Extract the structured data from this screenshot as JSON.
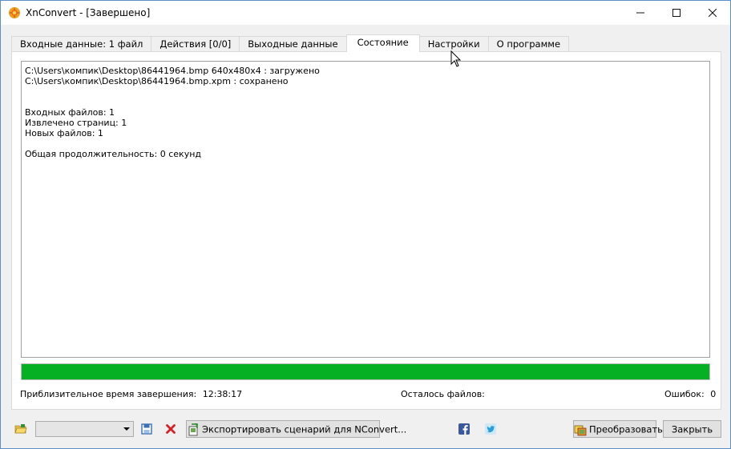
{
  "window": {
    "title": "XnConvert - [Завершено]",
    "minimize_icon": "minimize-icon",
    "maximize_icon": "maximize-icon",
    "close_icon": "close-icon"
  },
  "tabs": [
    {
      "label": "Входные данные: 1 файл",
      "active": false
    },
    {
      "label": "Действия [0/0]",
      "active": false
    },
    {
      "label": "Выходные данные",
      "active": false
    },
    {
      "label": "Состояние",
      "active": true
    },
    {
      "label": "Настройки",
      "active": false
    },
    {
      "label": "О программе",
      "active": false
    }
  ],
  "log": {
    "line1": "C:\\Users\\компик\\Desktop\\86441964.bmp 640x480x4 : загружено",
    "line2": "C:\\Users\\компик\\Desktop\\86441964.bmp.xpm : сохранено",
    "input_files": "Входных файлов: 1",
    "pages_extracted": "Извлечено страниц: 1",
    "new_files": "Новых файлов: 1",
    "total_duration": "Общая продолжительность: 0 секунд"
  },
  "progress": {
    "value_percent": 100,
    "color": "#06b025"
  },
  "status": {
    "eta_label": "Приблизительное время завершения:",
    "eta_value": "12:38:17",
    "remaining_label": "Осталось файлов:",
    "remaining_value": "",
    "errors_label": "Ошибок:",
    "errors_value": "0"
  },
  "toolbar": {
    "open_icon": "folder-open-icon",
    "script_select_value": "",
    "save_icon": "save-icon",
    "delete_icon": "delete-icon",
    "export_label": "Экспортировать сценарий для NConvert...",
    "facebook_icon": "facebook-icon",
    "twitter_icon": "twitter-icon",
    "convert_label": "Преобразовать",
    "close_label": "Закрыть"
  },
  "colors": {
    "accent_border": "#5c8fc6",
    "progress_green": "#06b025"
  }
}
